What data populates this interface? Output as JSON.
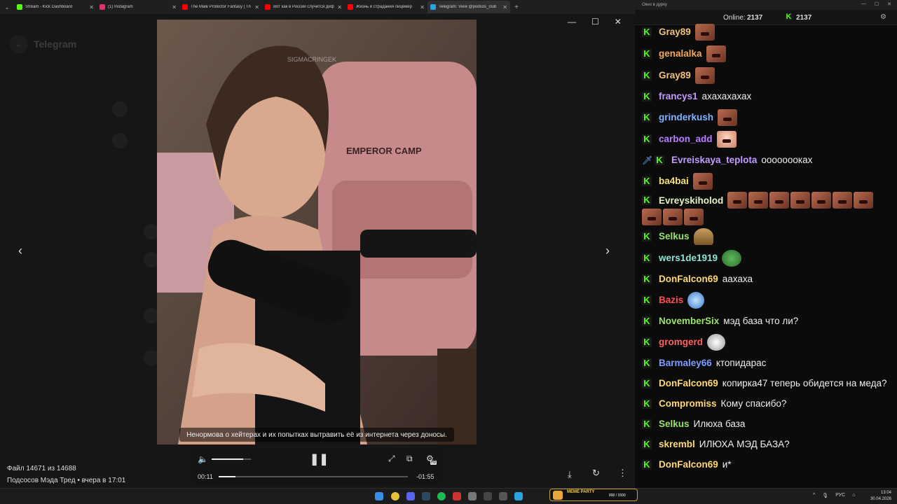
{
  "tabs": [
    {
      "title": "Stream - Kick Dashboard",
      "icon": "kick-icon",
      "color": "#53fc18"
    },
    {
      "title": "(1) Instagram",
      "icon": "instagram-icon",
      "color": "#e1306c"
    },
    {
      "title": "The Male Protector Fantasy | Th",
      "icon": "youtube-icon",
      "color": "#ff0000"
    },
    {
      "title": "Вот как в России случится диф",
      "icon": "youtube-icon",
      "color": "#ff0000"
    },
    {
      "title": "Жизнь и страдания лицемер",
      "icon": "youtube-icon",
      "color": "#ff0000"
    },
    {
      "title": "Telegram: View @podsos_club",
      "icon": "telegram-icon",
      "color": "#2aa3df",
      "active": true
    }
  ],
  "telegram": {
    "title": "Telegram"
  },
  "video": {
    "watermark": "SIGMACRINGEK",
    "chair_text": "EMPEROR CAMP",
    "subtitle": "Ненормова о хейтерах и их попытках вытравить её из интернета через доносы.",
    "time_current": "00:11",
    "time_remaining": "-01:55",
    "volume_fraction": 0.8,
    "progress_fraction": 0.09,
    "quality_badge": "HD"
  },
  "file_info": {
    "counter": "Файл 14671 из 14688",
    "source": "Подсосов Мэда Тред • вчера в 17:01"
  },
  "chat": {
    "window_title": "Окно в дурку",
    "online_label": "Online:",
    "online_count": "2137",
    "viewer_count": "2137",
    "messages": [
      {
        "user": "Gray89",
        "color": "#f2c27e",
        "text": "",
        "emotes": [
          "e"
        ]
      },
      {
        "user": "genalalka",
        "color": "#f2a95a",
        "text": "",
        "emotes": [
          "e"
        ]
      },
      {
        "user": "Gray89",
        "color": "#f2c27e",
        "text": "",
        "emotes": [
          "e"
        ]
      },
      {
        "user": "francys1",
        "color": "#c39bff",
        "text": "ахахахахах",
        "emotes": []
      },
      {
        "user": "grinderkush",
        "color": "#7fb2ff",
        "text": "",
        "emotes": [
          "e"
        ]
      },
      {
        "user": "carbon_add",
        "color": "#b77dff",
        "text": "",
        "emotes": [
          "g"
        ]
      },
      {
        "user": "Evreiskaya_teplota",
        "color": "#c39bff",
        "text": "оооооооках",
        "emotes": [],
        "sword": true
      },
      {
        "user": "ba4bai",
        "color": "#f4e27a",
        "text": "",
        "emotes": [
          "e"
        ]
      },
      {
        "user": "Evreyskiholod",
        "color": "#e3f3c6",
        "text": "",
        "emotes": [
          "e",
          "e",
          "e",
          "e",
          "e",
          "e",
          "e",
          "e",
          "e",
          "e"
        ]
      },
      {
        "user": "Selkus",
        "color": "#9be36a",
        "text": "",
        "emotes": [
          "gold"
        ]
      },
      {
        "user": "wers1de1919",
        "color": "#8fe3d1",
        "text": "",
        "emotes": [
          "pepe"
        ]
      },
      {
        "user": "DonFalcon69",
        "color": "#ffd86e",
        "text": "аахаха",
        "emotes": []
      },
      {
        "user": "Bazis",
        "color": "#ff4d4d",
        "text": "",
        "emotes": [
          "blue"
        ]
      },
      {
        "user": "NovemberSix",
        "color": "#9be36a",
        "text": "мэд база что ли?",
        "emotes": []
      },
      {
        "user": "gromgerd",
        "color": "#ff5e5e",
        "text": "",
        "emotes": [
          "mono"
        ]
      },
      {
        "user": "Barmaley66",
        "color": "#7e9cff",
        "text": "ктопидарас",
        "emotes": []
      },
      {
        "user": "DonFalcon69",
        "color": "#ffd86e",
        "text": "копирка47 теперь обидется на меда?",
        "emotes": []
      },
      {
        "user": "Compromiss",
        "color": "#ffd86e",
        "text": "Кому спасибо?",
        "emotes": []
      },
      {
        "user": "Selkus",
        "color": "#9be36a",
        "text": "Илюха база",
        "emotes": []
      },
      {
        "user": "skrembl",
        "color": "#ffd86e",
        "text": "ИЛЮХА МЭД БАЗА?",
        "emotes": []
      },
      {
        "user": "DonFalcon69",
        "color": "#ffd86e",
        "text": "и*",
        "emotes": []
      }
    ]
  },
  "taskbar": {
    "lang": "РУС",
    "time": "13:04",
    "date": "30.04.2026",
    "meme_title": "MEME PARTY",
    "meme_count": "800 / 1500"
  }
}
